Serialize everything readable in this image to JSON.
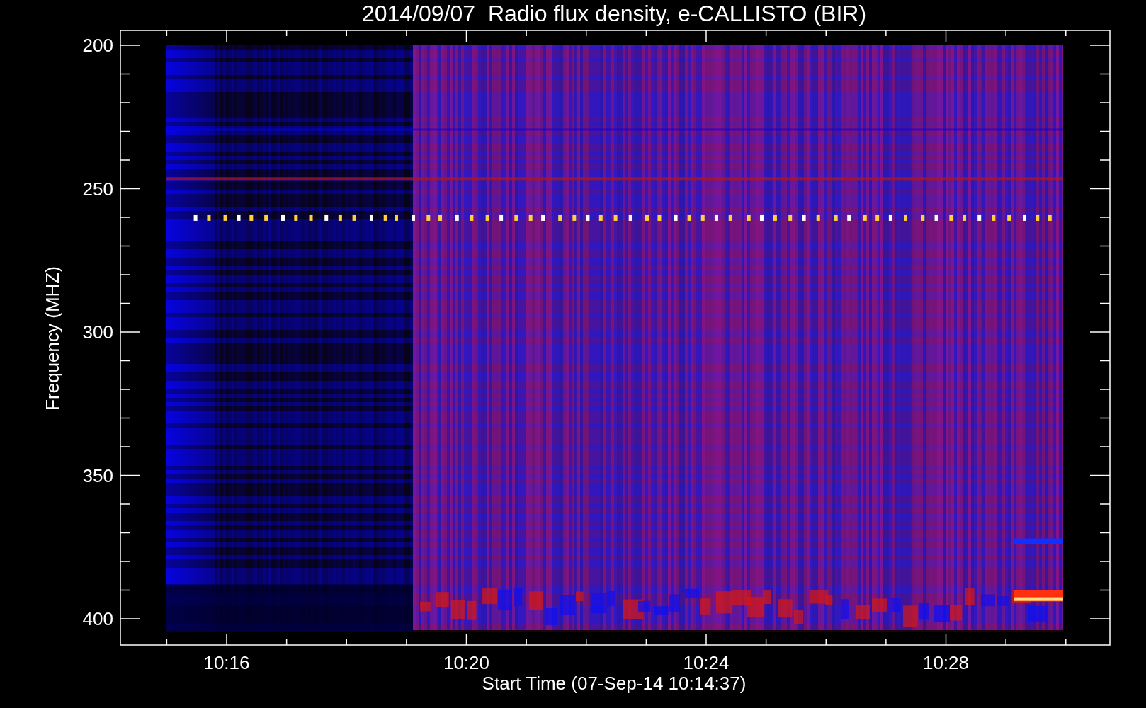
{
  "plot": {
    "title": "2014/09/07  Radio flux density, e-CALLISTO (BIR)",
    "ylabel": "Frequency (MHZ)",
    "xlabel": "Start Time (07-Sep-14 10:14:37)",
    "yticks": [
      "200",
      "250",
      "300",
      "350",
      "400"
    ],
    "xticks": [
      "10:16",
      "10:20",
      "10:24",
      "10:28"
    ]
  }
}
